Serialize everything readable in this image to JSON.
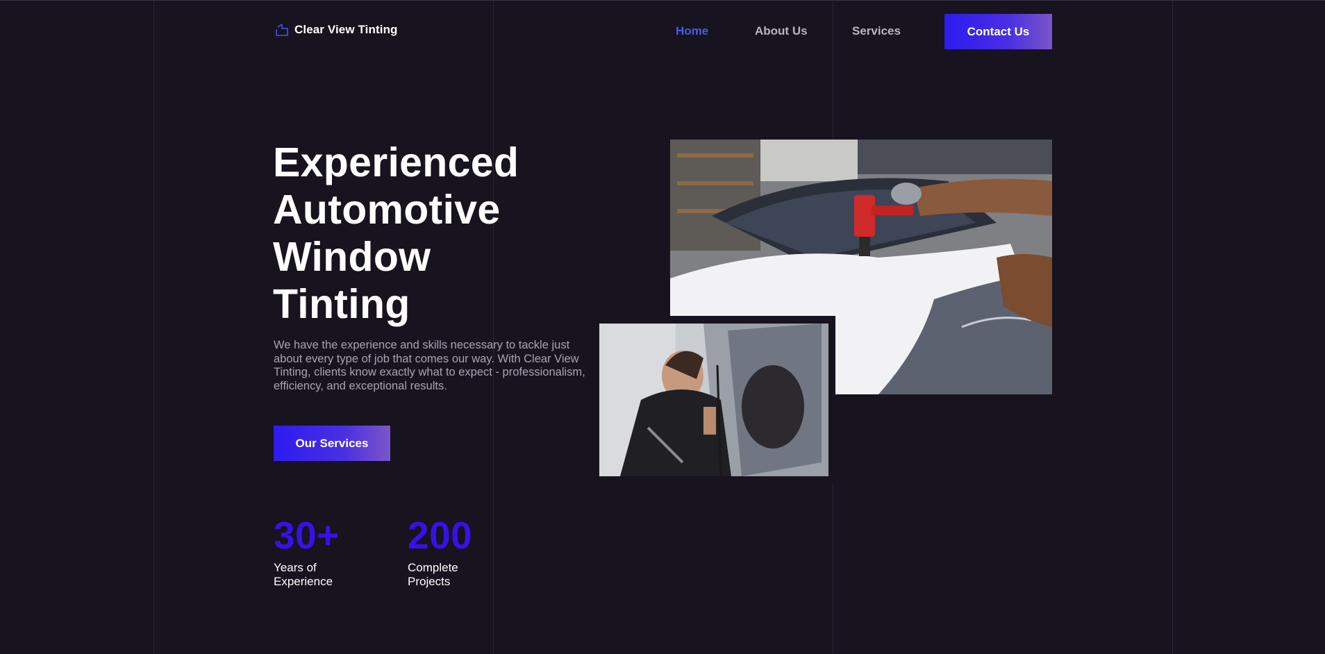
{
  "brand": {
    "name": "Clear View Tinting",
    "logo_icon": "house-outline-icon",
    "accent": "#3512e8"
  },
  "nav": {
    "items": [
      {
        "label": "Home",
        "active": true
      },
      {
        "label": "About Us",
        "active": false
      },
      {
        "label": "Services",
        "active": false
      }
    ],
    "contact_label": "Contact Us"
  },
  "hero": {
    "title_lines": [
      "Experienced",
      "Automotive",
      "Window",
      "Tinting"
    ],
    "description": "We have the experience and skills necessary to tackle just about every type of job that comes our way. With Clear View Tinting, clients know exactly what to expect - professionalism, efficiency, and exceptional results.",
    "cta_label": "Our Services"
  },
  "stats": [
    {
      "number": "30+",
      "label": "Years of Experience"
    },
    {
      "number": "200",
      "label": "Complete Projects"
    }
  ],
  "colors": {
    "background": "#17131f",
    "nav_active": "#4b5be6",
    "button_gradient_start": "#2d1bf0",
    "button_gradient_end": "#7a56c8"
  }
}
